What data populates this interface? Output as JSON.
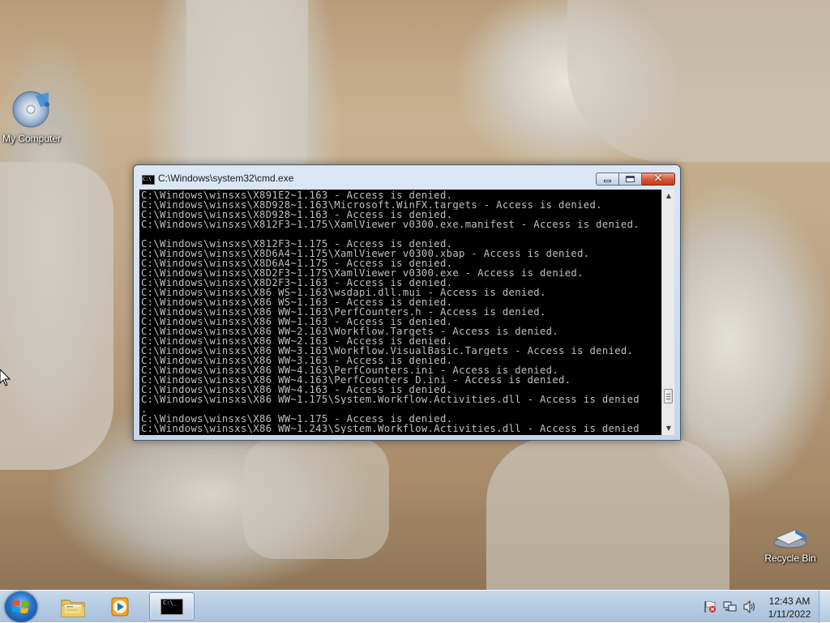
{
  "desktop": {
    "icons": [
      {
        "label": "My Computer",
        "icon": "disc-drive-icon"
      },
      {
        "label": "Recycle Bin",
        "icon": "recycle-bin-icon"
      }
    ]
  },
  "cmd_window": {
    "title": "C:\\Windows\\system32\\cmd.exe",
    "minimize_label": "",
    "maximize_label": "",
    "close_label": "✕",
    "title_icon_text": "C:\\",
    "lines": [
      "C:\\Windows\\winsxs\\X891E2~1.163 - Access is denied.",
      "C:\\Windows\\winsxs\\X8D928~1.163\\Microsoft.WinFX.targets - Access is denied.",
      "C:\\Windows\\winsxs\\X8D928~1.163 - Access is denied.",
      "C:\\Windows\\winsxs\\X812F3~1.175\\XamlViewer_v0300.exe.manifest - Access is denied.",
      "",
      "C:\\Windows\\winsxs\\X812F3~1.175 - Access is denied.",
      "C:\\Windows\\winsxs\\X8D6A4~1.175\\XamlViewer_v0300.xbap - Access is denied.",
      "C:\\Windows\\winsxs\\X8D6A4~1.175 - Access is denied.",
      "C:\\Windows\\winsxs\\X8D2F3~1.175\\XamlViewer_v0300.exe - Access is denied.",
      "C:\\Windows\\winsxs\\X8D2F3~1.163 - Access is denied.",
      "C:\\Windows\\winsxs\\X86_WS~1.163\\wsdapi.dll.mui - Access is denied.",
      "C:\\Windows\\winsxs\\X86_WS~1.163 - Access is denied.",
      "C:\\Windows\\winsxs\\X86_WW~1.163\\PerfCounters.h - Access is denied.",
      "C:\\Windows\\winsxs\\X86_WW~1.163 - Access is denied.",
      "C:\\Windows\\winsxs\\X86_WW~2.163\\Workflow.Targets - Access is denied.",
      "C:\\Windows\\winsxs\\X86_WW~2.163 - Access is denied.",
      "C:\\Windows\\winsxs\\X86_WW~3.163\\Workflow.VisualBasic.Targets - Access is denied.",
      "C:\\Windows\\winsxs\\X86_WW~3.163 - Access is denied.",
      "C:\\Windows\\winsxs\\X86_WW~4.163\\PerfCounters.ini - Access is denied.",
      "C:\\Windows\\winsxs\\X86_WW~4.163\\PerfCounters_D.ini - Access is denied.",
      "C:\\Windows\\winsxs\\X86_WW~4.163 - Access is denied.",
      "C:\\Windows\\winsxs\\X86_WW~1.175\\System.Workflow.Activities.dll - Access is denied",
      ".",
      "C:\\Windows\\winsxs\\X86_WW~1.175 - Access is denied.",
      "C:\\Windows\\winsxs\\X86_WW~1.243\\System.Workflow.Activities.dll - Access is denied"
    ]
  },
  "taskbar": {
    "buttons": [
      {
        "name": "windows-explorer",
        "icon": "folder-icon"
      },
      {
        "name": "windows-media-player",
        "icon": "media-player-icon"
      },
      {
        "name": "command-prompt",
        "icon": "cmd-icon",
        "icon_text": "C:\\_"
      }
    ],
    "tray_icons": [
      "action-center-flag-icon",
      "network-icon",
      "volume-icon"
    ],
    "clock": {
      "time": "12:43 AM",
      "date": "1/11/2022"
    }
  },
  "colors": {
    "console_background": "#000000",
    "console_text": "#c0c0c0",
    "taskbar": "#b7cde3",
    "close_button": "#c9452a"
  }
}
